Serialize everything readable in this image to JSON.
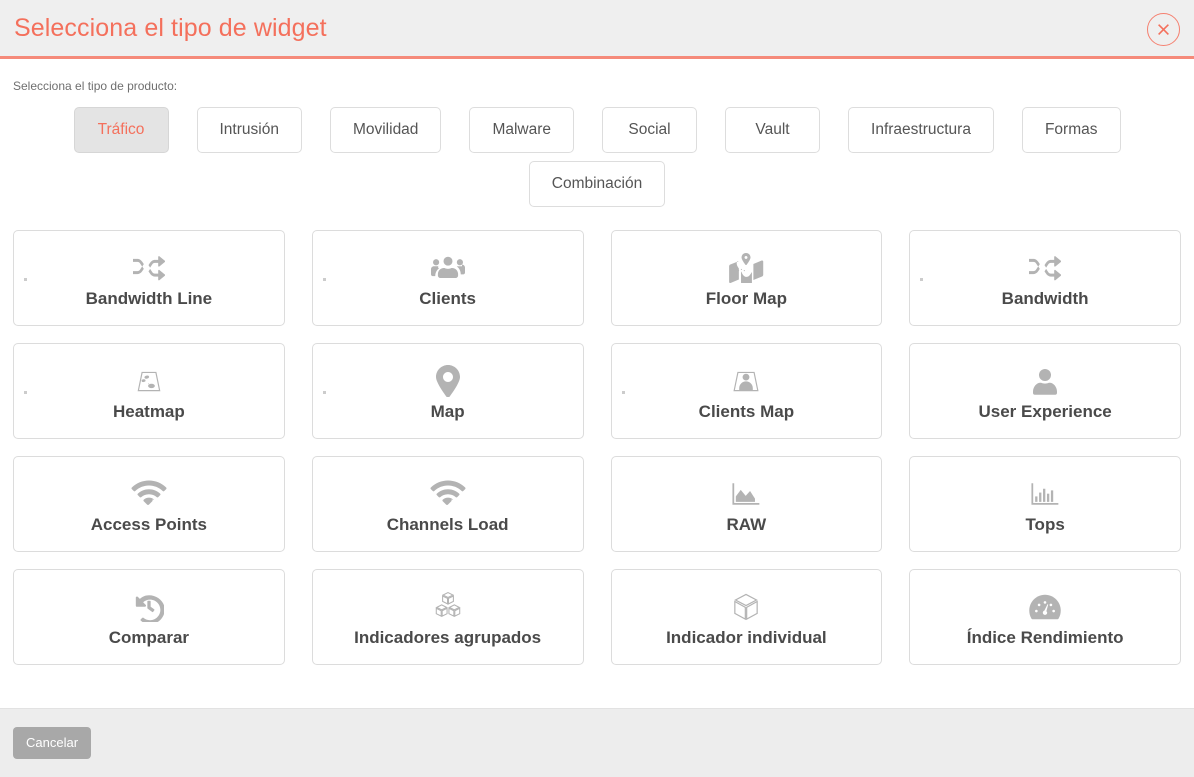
{
  "header": {
    "title": "Selecciona el tipo de widget",
    "close_label": "×",
    "accent_color": "#f4705c",
    "border_color": "#f58a7a"
  },
  "body": {
    "product_label": "Selecciona el tipo de producto:",
    "product_types": [
      {
        "label": "Tráfico",
        "active": true
      },
      {
        "label": "Intrusión",
        "active": false
      },
      {
        "label": "Movilidad",
        "active": false
      },
      {
        "label": "Malware",
        "active": false
      },
      {
        "label": "Social",
        "active": false
      },
      {
        "label": "Vault",
        "active": false
      },
      {
        "label": "Infraestructura",
        "active": false
      },
      {
        "label": "Formas",
        "active": false
      },
      {
        "label": "Combinación",
        "active": false
      }
    ],
    "widgets": [
      {
        "label": "Bandwidth Line",
        "icon": "shuffle-icon",
        "dot": true
      },
      {
        "label": "Clients",
        "icon": "users-icon",
        "dot": true
      },
      {
        "label": "Floor Map",
        "icon": "map-marked-icon",
        "dot": false
      },
      {
        "label": "Bandwidth",
        "icon": "shuffle-icon",
        "dot": true
      },
      {
        "label": "Heatmap",
        "icon": "heatmap-icon",
        "dot": true
      },
      {
        "label": "Map",
        "icon": "map-pin-icon",
        "dot": true
      },
      {
        "label": "Clients Map",
        "icon": "map-user-icon",
        "dot": true
      },
      {
        "label": "User Experience",
        "icon": "user-icon",
        "dot": false
      },
      {
        "label": "Access Points",
        "icon": "wifi-icon",
        "dot": false
      },
      {
        "label": "Channels Load",
        "icon": "wifi-icon",
        "dot": false
      },
      {
        "label": "RAW",
        "icon": "area-chart-icon",
        "dot": false
      },
      {
        "label": "Tops",
        "icon": "bar-chart-icon",
        "dot": false
      },
      {
        "label": "Comparar",
        "icon": "history-icon",
        "dot": false
      },
      {
        "label": "Indicadores agrupados",
        "icon": "cubes-icon",
        "dot": false
      },
      {
        "label": "Indicador individual",
        "icon": "cube-icon",
        "dot": false
      },
      {
        "label": "Índice Rendimiento",
        "icon": "tachometer-icon",
        "dot": false
      }
    ]
  },
  "footer": {
    "cancel_label": "Cancelar"
  }
}
